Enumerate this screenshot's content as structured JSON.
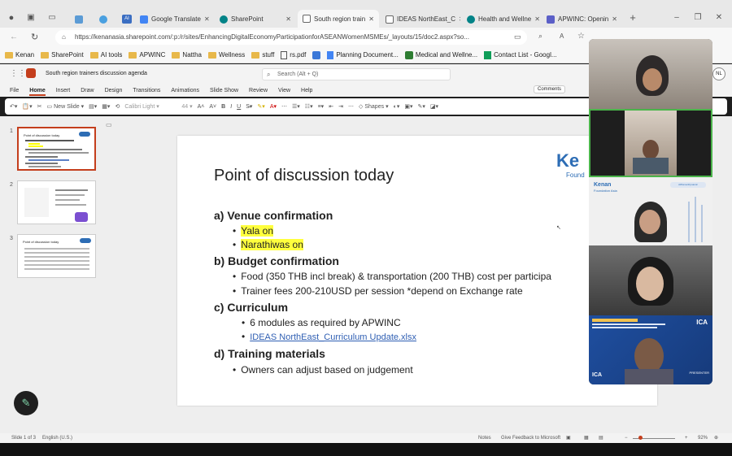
{
  "tabs": [
    {
      "label": "",
      "fav": "#5b9bd5"
    },
    {
      "label": "AI",
      "fav": "#3b6ec2"
    },
    {
      "label": "Google Translate",
      "fav": "#4285f4"
    },
    {
      "label": "SharePoint",
      "fav": "#038387"
    },
    {
      "label": "South region train",
      "fav": "#555"
    },
    {
      "label": "IDEAS NorthEast_C",
      "fav": "#555"
    },
    {
      "label": "Health and Wellne",
      "fav": "#038387"
    },
    {
      "label": "APWINC: Openin",
      "fav": "#5b5fc7"
    }
  ],
  "url": "https://kenanasia.sharepoint.com/:p:/r/sites/EnhancingDigitalEconomyParticipationforASEANWomenMSMEs/_layouts/15/doc2.aspx?so...",
  "bookmarks": [
    "Kenan",
    "SharePoint",
    "AI tools",
    "APWINC",
    "Nattha",
    "Wellness",
    "stuff",
    "rs.pdf",
    "Planning Document...",
    "Medical and Wellne...",
    "Contact List - Googl..."
  ],
  "doc_title": "South region trainers discussion agenda",
  "search_placeholder": "Search (Alt + Q)",
  "user_initials": "NL",
  "ribbon_tabs": [
    "File",
    "Home",
    "Insert",
    "Draw",
    "Design",
    "Transitions",
    "Animations",
    "Slide Show",
    "Review",
    "View",
    "Help"
  ],
  "ribbon": {
    "new_slide": "New Slide",
    "font": "Calibri Light",
    "size": "44",
    "shapes": "Shapes",
    "comments": "Comments"
  },
  "thumbs": [
    "1",
    "2",
    "3"
  ],
  "thumb1_title": "Point of discussion today",
  "thumb3_title": "Point of discussion today",
  "slide": {
    "title": "Point of discussion today",
    "logo_text": "Ke",
    "logo_sub": "Found",
    "a": "a)  Venue confirmation",
    "a1": "Yala on",
    "a2": "Narathiwas on",
    "b": "b)  Budget confirmation",
    "b1": "Food (350 THB incl break) & transportation (200 THB) cost per participa",
    "b2": "Trainer fees 200-210USD per session *depend on Exchange rate",
    "c": "c)  Curriculum",
    "c1": "6 modules as required by APWINC",
    "c2": "IDEAS NorthEast_Curriculum Update.xlsx",
    "d": "d)  Training materials",
    "d1": "Owners can adjust based on judgement"
  },
  "status": {
    "slide": "Slide 1 of 3",
    "lang": "English (U.S.)",
    "notes": "Notes",
    "feedback": "Give Feedback to Microsoft",
    "zoom": "92%"
  },
  "video": {
    "tile3_logo": "Kenan",
    "tile3_sub": "Foundation Asia",
    "tile3_badge": "AWomenDynamic",
    "tile5_presenter": "PRESENTER",
    "tile5_logo": "ICA"
  }
}
